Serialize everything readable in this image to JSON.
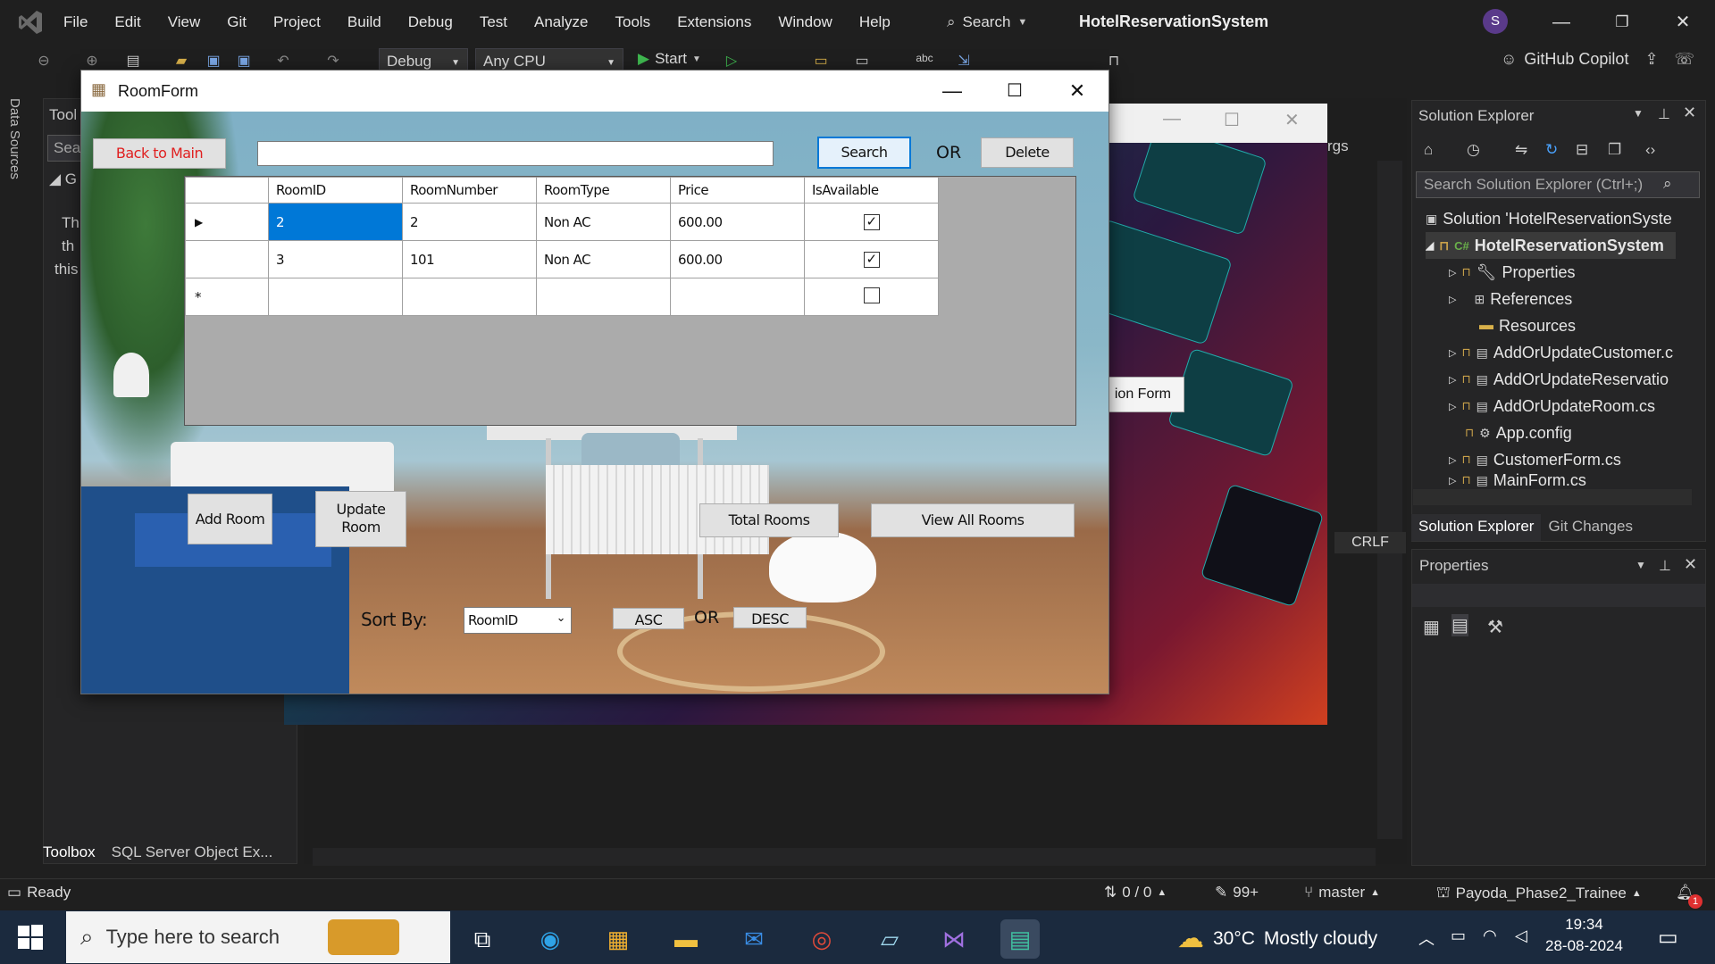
{
  "vs": {
    "menu": [
      "File",
      "Edit",
      "View",
      "Git",
      "Project",
      "Build",
      "Debug",
      "Test",
      "Analyze",
      "Tools",
      "Extensions",
      "Window",
      "Help"
    ],
    "search_label": "Search",
    "solution_title": "HotelReservationSystem",
    "avatar_initial": "S",
    "config": "Debug",
    "platform": "Any CPU",
    "start_label": "Start",
    "copilot_label": "GitHub Copilot",
    "data_sources": "Data Sources",
    "toolbox_title": "Tool",
    "toolbox_search": "Sea",
    "toolbox_group": "G",
    "toolbox_text": [
      "Th",
      "th",
      "this"
    ],
    "toolbox_tabs": [
      "Toolbox",
      "SQL Server Object Ex..."
    ],
    "crlf": "CRLF",
    "bg_args": "rgs",
    "bg_button": "ion Form"
  },
  "solution_explorer": {
    "title": "Solution Explorer",
    "search_placeholder": "Search Solution Explorer (Ctrl+;)",
    "items": [
      {
        "label": "Solution 'HotelReservationSyste"
      },
      {
        "label": "HotelReservationSystem"
      },
      {
        "label": "Properties"
      },
      {
        "label": "References"
      },
      {
        "label": "Resources"
      },
      {
        "label": "AddOrUpdateCustomer.c"
      },
      {
        "label": "AddOrUpdateReservatio"
      },
      {
        "label": "AddOrUpdateRoom.cs"
      },
      {
        "label": "App.config"
      },
      {
        "label": "CustomerForm.cs"
      },
      {
        "label": "MainForm.cs"
      }
    ],
    "tabs": [
      "Solution Explorer",
      "Git Changes"
    ]
  },
  "properties": {
    "title": "Properties"
  },
  "status": {
    "ready": "Ready",
    "errors": "0 / 0",
    "edits": "99+",
    "branch": "master",
    "repo": "Payoda_Phase2_Trainee",
    "notif": "1"
  },
  "taskbar": {
    "search_placeholder": "Type here to search",
    "temp": "30°C",
    "weather": "Mostly cloudy",
    "time": "19:34",
    "date": "28-08-2024"
  },
  "roomform": {
    "title": "RoomForm",
    "back_label": "Back to Main",
    "search_value": "",
    "search_label": "Search",
    "or_label": "OR",
    "delete_label": "Delete",
    "columns": [
      "RoomID",
      "RoomNumber",
      "RoomType",
      "Price",
      "IsAvailable"
    ],
    "rows": [
      {
        "marker": "▶",
        "RoomID": "2",
        "RoomNumber": "2",
        "RoomType": "Non AC",
        "Price": "600.00",
        "IsAvailable": "✓"
      },
      {
        "marker": "",
        "RoomID": "3",
        "RoomNumber": "101",
        "RoomType": "Non AC",
        "Price": "600.00",
        "IsAvailable": "✓"
      },
      {
        "marker": "*",
        "RoomID": "",
        "RoomNumber": "",
        "RoomType": "",
        "Price": "",
        "IsAvailable": ""
      }
    ],
    "add_label": "Add Room",
    "update_label": "Update\nRoom",
    "total_label": "Total Rooms",
    "view_all_label": "View All Rooms",
    "sort_label": "Sort By:",
    "sort_value": "RoomID",
    "asc_label": "ASC",
    "or2_label": "OR",
    "desc_label": "DESC"
  }
}
